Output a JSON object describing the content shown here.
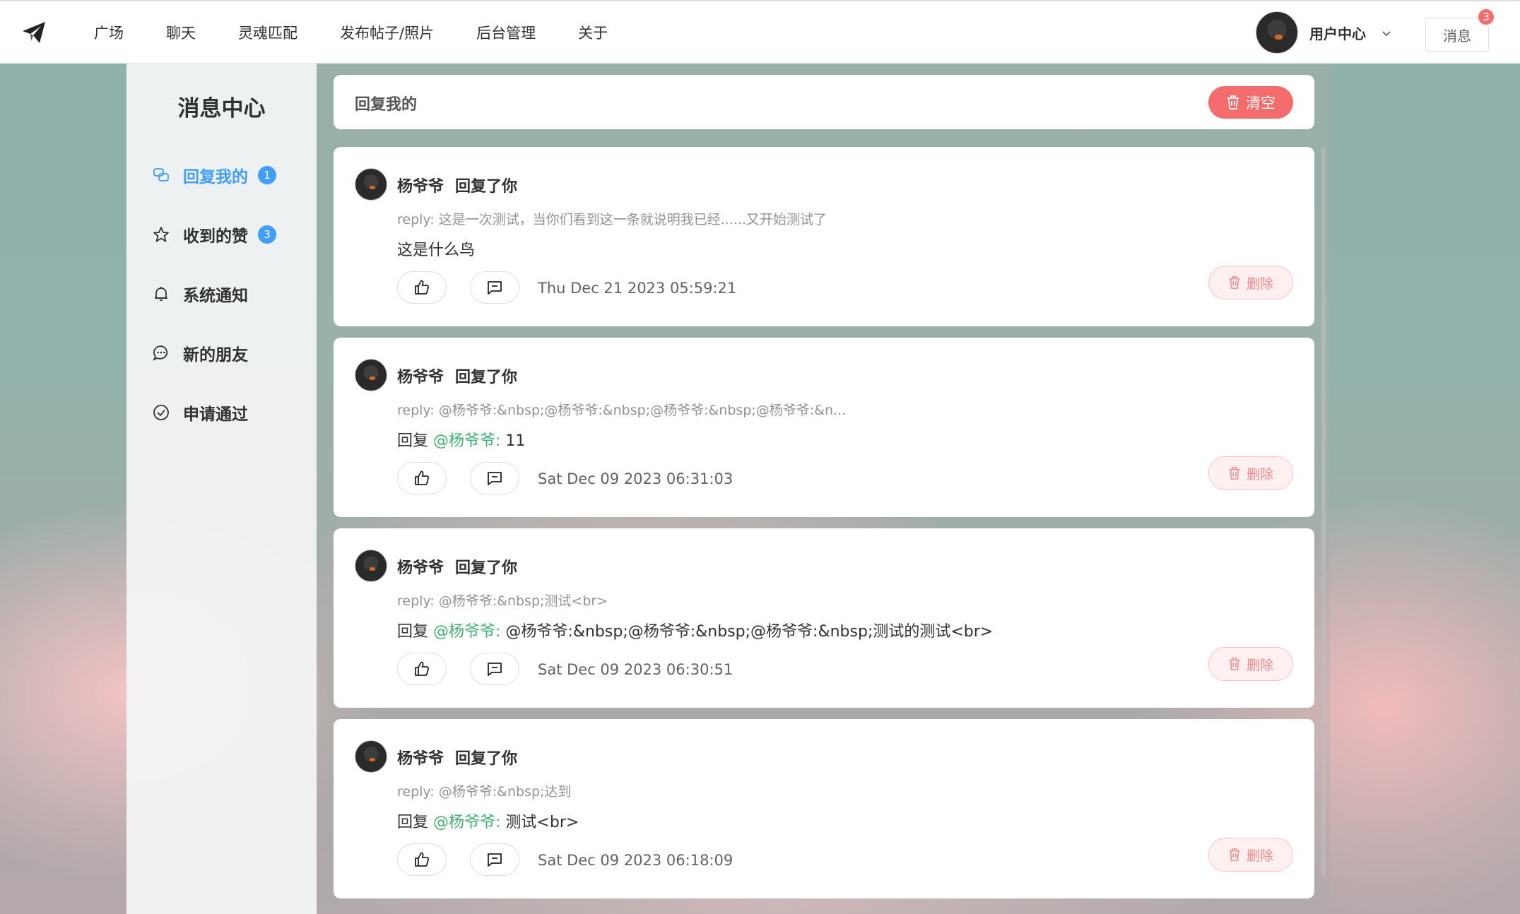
{
  "nav": {
    "items": [
      "广场",
      "聊天",
      "灵魂匹配",
      "发布帖子/照片",
      "后台管理",
      "关于"
    ]
  },
  "user": {
    "label": "用户中心"
  },
  "messages": {
    "label": "消息",
    "badge": "3"
  },
  "sidebar": {
    "title": "消息中心",
    "items": [
      {
        "label": "回复我的",
        "icon": "reply-icon",
        "badge": "1",
        "active": true
      },
      {
        "label": "收到的赞",
        "icon": "star-icon",
        "badge": "3",
        "active": false
      },
      {
        "label": "系统通知",
        "icon": "bell-icon",
        "badge": "",
        "active": false
      },
      {
        "label": "新的朋友",
        "icon": "chat-icon",
        "badge": "",
        "active": false
      },
      {
        "label": "申请通过",
        "icon": "check-circle-icon",
        "badge": "",
        "active": false
      }
    ]
  },
  "header": {
    "title": "回复我的",
    "clear_label": "清空"
  },
  "cards": [
    {
      "name": "杨爷爷",
      "action": "回复了你",
      "reply": "reply: 这是一次测试，当你们看到这一条就说明我已经......又开始测试了",
      "prefix": "",
      "mention": "",
      "content": "这是什么鸟",
      "time": "Thu Dec 21 2023 05:59:21",
      "delete_label": "删除"
    },
    {
      "name": "杨爷爷",
      "action": "回复了你",
      "reply": "reply: @杨爷爷:&nbsp;@杨爷爷:&nbsp;@杨爷爷:&nbsp;@杨爷爷:&n...",
      "prefix": "回复 ",
      "mention": "@杨爷爷:",
      "content": " 11",
      "time": "Sat Dec 09 2023 06:31:03",
      "delete_label": "删除"
    },
    {
      "name": "杨爷爷",
      "action": "回复了你",
      "reply": "reply: @杨爷爷:&nbsp;测试<br>",
      "prefix": "回复 ",
      "mention": "@杨爷爷:",
      "content": " @杨爷爷:&nbsp;@杨爷爷:&nbsp;@杨爷爷:&nbsp;测试的测试<br>",
      "time": "Sat Dec 09 2023 06:30:51",
      "delete_label": "删除"
    },
    {
      "name": "杨爷爷",
      "action": "回复了你",
      "reply": "reply: @杨爷爷:&nbsp;达到",
      "prefix": "回复 ",
      "mention": "@杨爷爷:",
      "content": " 测试<br>",
      "time": "Sat Dec 09 2023 06:18:09",
      "delete_label": "删除"
    }
  ],
  "colors": {
    "accent": "#409eff",
    "danger": "#f56c6c",
    "mention": "#3cb371"
  }
}
